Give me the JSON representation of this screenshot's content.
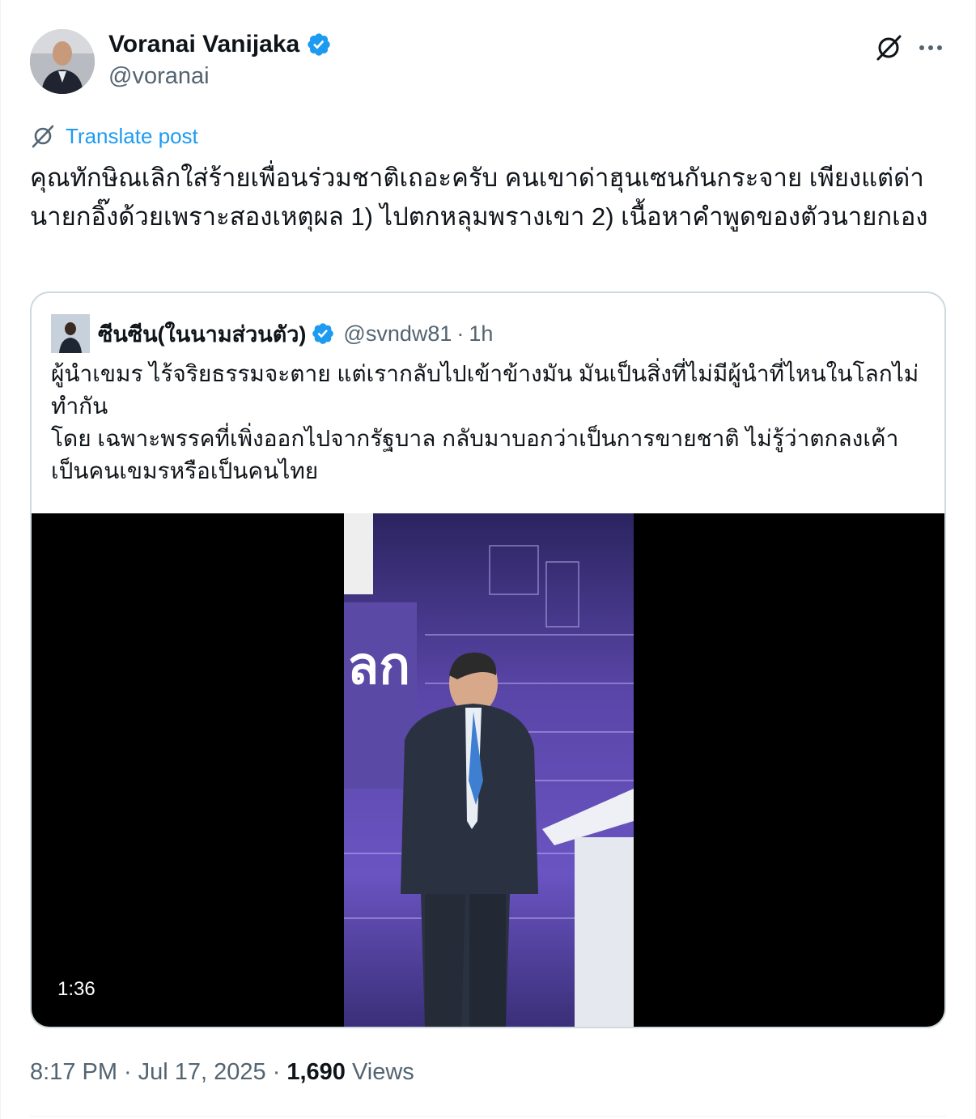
{
  "author": {
    "name": "Voranai Vanijaka",
    "handle": "@voranai",
    "verified": true
  },
  "translate": {
    "label": "Translate post"
  },
  "post": {
    "text": "คุณทักษิณเลิกใส่ร้ายเพื่อนร่วมชาติเถอะครับ คนเขาด่าฮุนเซนกันกระจาย เพียงแต่ด่านายกอิ๊งด้วยเพราะสองเหตุผล 1) ไปตกหลุมพรางเขา 2) เนื้อหาคำพูดของตัวนายกเอง"
  },
  "quote": {
    "name": "ซีนซีน(ในนามส่วนตัว)",
    "handle": "@svndw81",
    "separator": "·",
    "time": "1h",
    "verified": true,
    "lines": [
      "ผู้นำเขมร ไร้จริยธรรมจะตาย แต่เรากลับไปเข้าข้างมัน มันเป็นสิ่งที่ไม่มีผู้นำที่ไหนในโลกไม่ทำกัน",
      "โดย เฉพาะพรรคที่เพิ่งออกไปจากรัฐบาล กลับมาบอกว่าเป็นการขายชาติ ไม่รู้ว่าตกลงเค้าเป็นคนเขมรหรือเป็นคนไทย"
    ],
    "video": {
      "duration": "1:36",
      "stage_text": "ลก"
    }
  },
  "meta": {
    "time": "8:17 PM",
    "sep1": "·",
    "date": "Jul 17, 2025",
    "sep2": "·",
    "views_count": "1,690",
    "views_label": "Views"
  },
  "icons": {
    "verified": "verified-badge-icon",
    "grok": "grok-icon",
    "more": "more-icon",
    "translate": "grok-translate-icon"
  },
  "colors": {
    "accent": "#1d9bf0",
    "text": "#0f1419",
    "secondary": "#536471",
    "border": "#cfd9de"
  }
}
